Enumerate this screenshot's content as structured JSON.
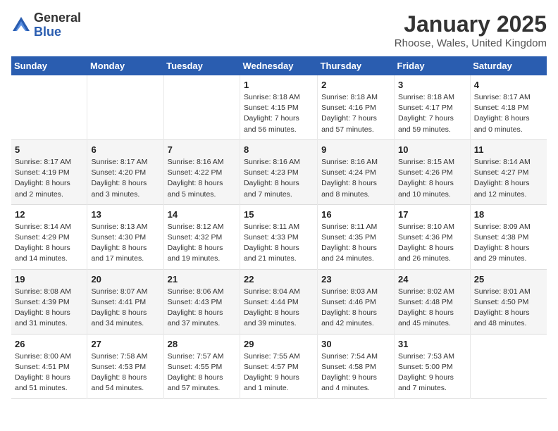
{
  "logo": {
    "general": "General",
    "blue": "Blue"
  },
  "title": "January 2025",
  "location": "Rhoose, Wales, United Kingdom",
  "weekdays": [
    "Sunday",
    "Monday",
    "Tuesday",
    "Wednesday",
    "Thursday",
    "Friday",
    "Saturday"
  ],
  "weeks": [
    [
      {
        "day": "",
        "info": ""
      },
      {
        "day": "",
        "info": ""
      },
      {
        "day": "",
        "info": ""
      },
      {
        "day": "1",
        "info": "Sunrise: 8:18 AM\nSunset: 4:15 PM\nDaylight: 7 hours\nand 56 minutes."
      },
      {
        "day": "2",
        "info": "Sunrise: 8:18 AM\nSunset: 4:16 PM\nDaylight: 7 hours\nand 57 minutes."
      },
      {
        "day": "3",
        "info": "Sunrise: 8:18 AM\nSunset: 4:17 PM\nDaylight: 7 hours\nand 59 minutes."
      },
      {
        "day": "4",
        "info": "Sunrise: 8:17 AM\nSunset: 4:18 PM\nDaylight: 8 hours\nand 0 minutes."
      }
    ],
    [
      {
        "day": "5",
        "info": "Sunrise: 8:17 AM\nSunset: 4:19 PM\nDaylight: 8 hours\nand 2 minutes."
      },
      {
        "day": "6",
        "info": "Sunrise: 8:17 AM\nSunset: 4:20 PM\nDaylight: 8 hours\nand 3 minutes."
      },
      {
        "day": "7",
        "info": "Sunrise: 8:16 AM\nSunset: 4:22 PM\nDaylight: 8 hours\nand 5 minutes."
      },
      {
        "day": "8",
        "info": "Sunrise: 8:16 AM\nSunset: 4:23 PM\nDaylight: 8 hours\nand 7 minutes."
      },
      {
        "day": "9",
        "info": "Sunrise: 8:16 AM\nSunset: 4:24 PM\nDaylight: 8 hours\nand 8 minutes."
      },
      {
        "day": "10",
        "info": "Sunrise: 8:15 AM\nSunset: 4:26 PM\nDaylight: 8 hours\nand 10 minutes."
      },
      {
        "day": "11",
        "info": "Sunrise: 8:14 AM\nSunset: 4:27 PM\nDaylight: 8 hours\nand 12 minutes."
      }
    ],
    [
      {
        "day": "12",
        "info": "Sunrise: 8:14 AM\nSunset: 4:29 PM\nDaylight: 8 hours\nand 14 minutes."
      },
      {
        "day": "13",
        "info": "Sunrise: 8:13 AM\nSunset: 4:30 PM\nDaylight: 8 hours\nand 17 minutes."
      },
      {
        "day": "14",
        "info": "Sunrise: 8:12 AM\nSunset: 4:32 PM\nDaylight: 8 hours\nand 19 minutes."
      },
      {
        "day": "15",
        "info": "Sunrise: 8:11 AM\nSunset: 4:33 PM\nDaylight: 8 hours\nand 21 minutes."
      },
      {
        "day": "16",
        "info": "Sunrise: 8:11 AM\nSunset: 4:35 PM\nDaylight: 8 hours\nand 24 minutes."
      },
      {
        "day": "17",
        "info": "Sunrise: 8:10 AM\nSunset: 4:36 PM\nDaylight: 8 hours\nand 26 minutes."
      },
      {
        "day": "18",
        "info": "Sunrise: 8:09 AM\nSunset: 4:38 PM\nDaylight: 8 hours\nand 29 minutes."
      }
    ],
    [
      {
        "day": "19",
        "info": "Sunrise: 8:08 AM\nSunset: 4:39 PM\nDaylight: 8 hours\nand 31 minutes."
      },
      {
        "day": "20",
        "info": "Sunrise: 8:07 AM\nSunset: 4:41 PM\nDaylight: 8 hours\nand 34 minutes."
      },
      {
        "day": "21",
        "info": "Sunrise: 8:06 AM\nSunset: 4:43 PM\nDaylight: 8 hours\nand 37 minutes."
      },
      {
        "day": "22",
        "info": "Sunrise: 8:04 AM\nSunset: 4:44 PM\nDaylight: 8 hours\nand 39 minutes."
      },
      {
        "day": "23",
        "info": "Sunrise: 8:03 AM\nSunset: 4:46 PM\nDaylight: 8 hours\nand 42 minutes."
      },
      {
        "day": "24",
        "info": "Sunrise: 8:02 AM\nSunset: 4:48 PM\nDaylight: 8 hours\nand 45 minutes."
      },
      {
        "day": "25",
        "info": "Sunrise: 8:01 AM\nSunset: 4:50 PM\nDaylight: 8 hours\nand 48 minutes."
      }
    ],
    [
      {
        "day": "26",
        "info": "Sunrise: 8:00 AM\nSunset: 4:51 PM\nDaylight: 8 hours\nand 51 minutes."
      },
      {
        "day": "27",
        "info": "Sunrise: 7:58 AM\nSunset: 4:53 PM\nDaylight: 8 hours\nand 54 minutes."
      },
      {
        "day": "28",
        "info": "Sunrise: 7:57 AM\nSunset: 4:55 PM\nDaylight: 8 hours\nand 57 minutes."
      },
      {
        "day": "29",
        "info": "Sunrise: 7:55 AM\nSunset: 4:57 PM\nDaylight: 9 hours\nand 1 minute."
      },
      {
        "day": "30",
        "info": "Sunrise: 7:54 AM\nSunset: 4:58 PM\nDaylight: 9 hours\nand 4 minutes."
      },
      {
        "day": "31",
        "info": "Sunrise: 7:53 AM\nSunset: 5:00 PM\nDaylight: 9 hours\nand 7 minutes."
      },
      {
        "day": "",
        "info": ""
      }
    ]
  ]
}
